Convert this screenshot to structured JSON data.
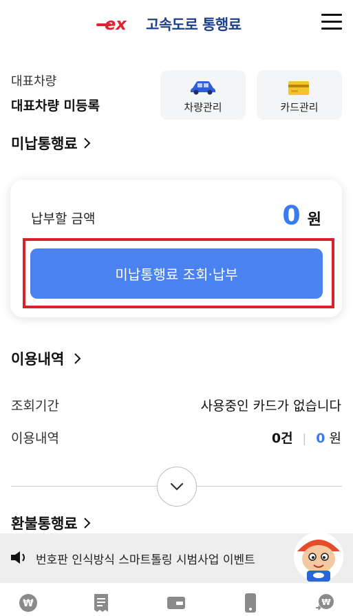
{
  "header": {
    "logo_text": "ex",
    "title": "고속도로 통행료"
  },
  "vehicle": {
    "label": "대표차량",
    "value": "대표차량 미등록",
    "vehicle_manage_label": "차량관리",
    "card_manage_label": "카드관리"
  },
  "unpaid": {
    "section_title": "미납통행료",
    "amount_label": "납부할 금액",
    "amount_value": "0",
    "amount_unit": "원",
    "pay_button_label": "미납통행료 조회·납부"
  },
  "usage": {
    "section_title": "이용내역",
    "period_label": "조회기간",
    "period_value": "사용중인 카드가 없습니다",
    "history_label": "이용내역",
    "count_value": "0",
    "count_unit": "건",
    "separator": "|",
    "amount_value": "0",
    "amount_unit": "원"
  },
  "refund": {
    "section_title": "환불통행료"
  },
  "banner": {
    "text": "번호판 인식방식 스마트톨링 시범사업 이벤트"
  },
  "bottom_tabs": {
    "icons": [
      "won-icon",
      "receipt-icon",
      "card-icon",
      "phone-icon",
      "refund-icon"
    ]
  },
  "colors": {
    "brand_blue": "#1d3f8f",
    "accent_blue": "#4a83ef",
    "amount_blue": "#3a7bf0",
    "highlight_red": "#d9232c",
    "logo_red": "#e3222f"
  }
}
